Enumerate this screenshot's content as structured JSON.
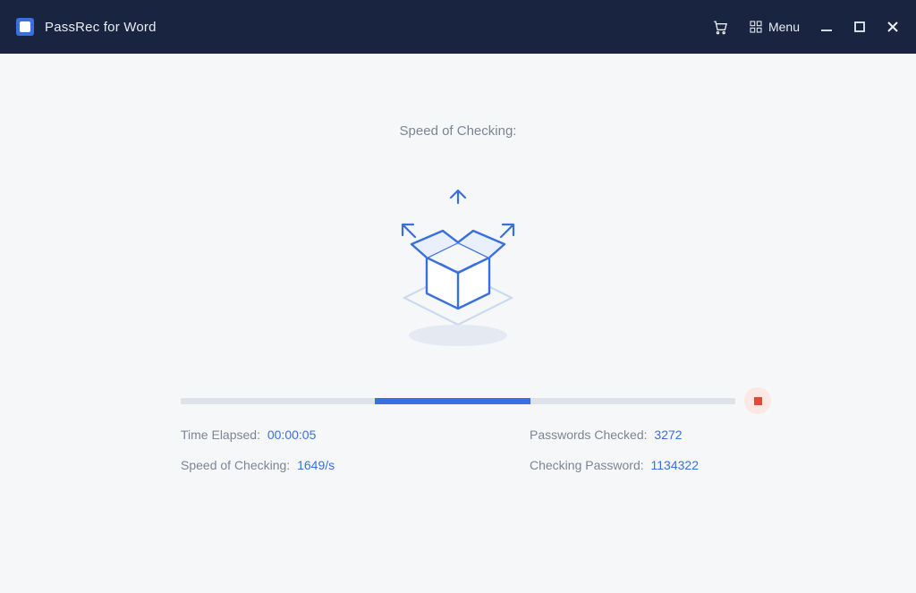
{
  "titlebar": {
    "app_title": "PassRec for Word",
    "menu_label": "Menu"
  },
  "main": {
    "heading": "Speed of Checking:"
  },
  "stats": {
    "time_elapsed_label": "Time Elapsed:",
    "time_elapsed_value": "00:00:05",
    "speed_label": "Speed of Checking:",
    "speed_value": "1649/s",
    "passwords_checked_label": "Passwords Checked:",
    "passwords_checked_value": "3272",
    "checking_password_label": "Checking Password:",
    "checking_password_value": "1134322"
  },
  "progress": {
    "chunk_left_pct": 35,
    "chunk_width_pct": 28
  }
}
